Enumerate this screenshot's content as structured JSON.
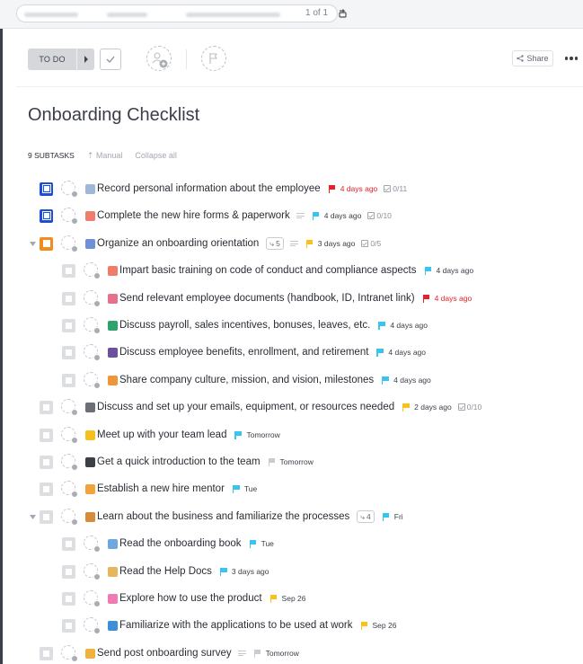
{
  "header": {
    "pager": "1 of 1"
  },
  "toolbar": {
    "status": "TO DO",
    "share": "Share"
  },
  "page": {
    "title": "Onboarding Checklist",
    "subtask_count": "9 SUBTASKS",
    "sort_mode": "Manual",
    "collapse_all": "Collapse all"
  },
  "colors": {
    "red_flag": "#e8202a",
    "blue_flag": "#37c5f0",
    "yellow_flag": "#f8c21b",
    "grey_flag": "#c8ccd2",
    "status_blue": "#1b4fd9",
    "status_orange": "#f28c1c"
  },
  "tasks": [
    {
      "name": "Record personal information about the employee",
      "due": "4 days ago",
      "priority": "red",
      "checklist": "0/11",
      "status_color": "blue",
      "icon": "notepad-icon"
    },
    {
      "name": "Complete the new hire forms & paperwork",
      "due": "4 days ago",
      "priority": "blue",
      "checklist": "0/10",
      "status_color": "blue",
      "icon": "memo-icon"
    },
    {
      "name": "Organize an onboarding orientation",
      "due": "3 days ago",
      "priority": "yellow",
      "checklist": "0/5",
      "subtasks": "5",
      "status_color": "orange",
      "icon": "books-icon",
      "children": [
        {
          "name": "Impart basic training on code of conduct and compliance aspects",
          "due": "4 days ago",
          "priority": "blue",
          "icon": "memo-icon"
        },
        {
          "name": "Send relevant employee documents (handbook, ID, Intranet link)",
          "due": "4 days ago",
          "priority": "red",
          "icon": "document-icon"
        },
        {
          "name": "Discuss payroll, sales incentives, bonuses, leaves, etc.",
          "due": "4 days ago",
          "priority": "blue",
          "icon": "money-icon"
        },
        {
          "name": "Discuss employee benefits, enrollment, and retirement",
          "due": "4 days ago",
          "priority": "blue",
          "icon": "speech-icon"
        },
        {
          "name": "Share company culture, mission, and vision, milestones",
          "due": "4 days ago",
          "priority": "blue",
          "icon": "statue-icon"
        }
      ]
    },
    {
      "name": "Discuss and set up your emails, equipment, or resources needed",
      "due": "2 days ago",
      "priority": "yellow",
      "checklist": "0/10",
      "icon": "technician-icon"
    },
    {
      "name": "Meet up with your team lead",
      "due": "Tomorrow",
      "priority": "blue",
      "icon": "heart-icon"
    },
    {
      "name": "Get a quick introduction to the team",
      "due": "Tomorrow",
      "priority": "grey",
      "icon": "person-icon"
    },
    {
      "name": "Establish a new hire mentor",
      "due": "Tue",
      "priority": "blue",
      "icon": "mentor-icon"
    },
    {
      "name": "Learn about the business and familiarize the processes",
      "due": "Fri",
      "priority": "blue",
      "subtasks": "4",
      "icon": "working-icon",
      "children": [
        {
          "name": "Read the onboarding book",
          "due": "Tue",
          "priority": "blue",
          "icon": "book-icon"
        },
        {
          "name": "Read the Help Docs",
          "due": "3 days ago",
          "priority": "blue",
          "icon": "scroll-icon"
        },
        {
          "name": "Explore how to use the product",
          "due": "Sep 26",
          "priority": "yellow",
          "icon": "brain-icon"
        },
        {
          "name": "Familiarize with the applications to be used at work",
          "due": "Sep 26",
          "priority": "yellow",
          "icon": "laptop-icon"
        }
      ]
    },
    {
      "name": "Send post onboarding survey",
      "due": "Tomorrow",
      "priority": "grey",
      "icon": "face-icon"
    }
  ]
}
